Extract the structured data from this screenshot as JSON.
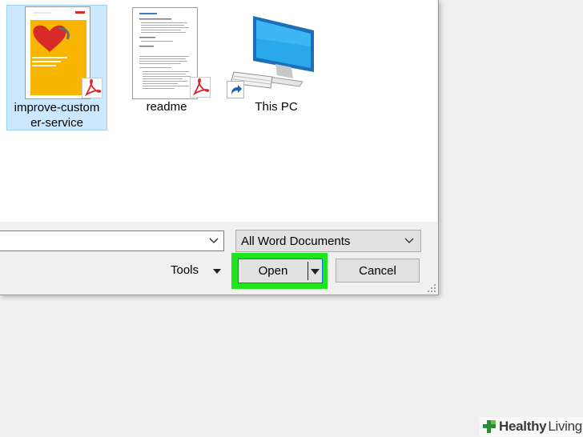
{
  "files": [
    {
      "name": "improve-custom\ner-service",
      "selected": true,
      "icon": "pdf-document-icon"
    },
    {
      "name": "readme",
      "selected": false,
      "icon": "pdf-document-icon"
    },
    {
      "name": "This PC",
      "selected": false,
      "icon": "computer-shortcut-icon"
    }
  ],
  "footer": {
    "filename_value": "",
    "filetype_selected": "All Word Documents",
    "tools_label": "Tools",
    "open_label": "Open",
    "cancel_label": "Cancel"
  },
  "watermark": {
    "brand_bold": "Healthy",
    "brand_rest": "Living"
  },
  "colors": {
    "selection_fill": "#cce8ff",
    "selection_border": "#99d1ff",
    "highlight_green": "#1fe41f",
    "button_focus_border": "#0078d7",
    "thumbnail_orange": "#f7b500",
    "heart_red": "#d92a2a",
    "pdf_red": "#d8272d"
  }
}
